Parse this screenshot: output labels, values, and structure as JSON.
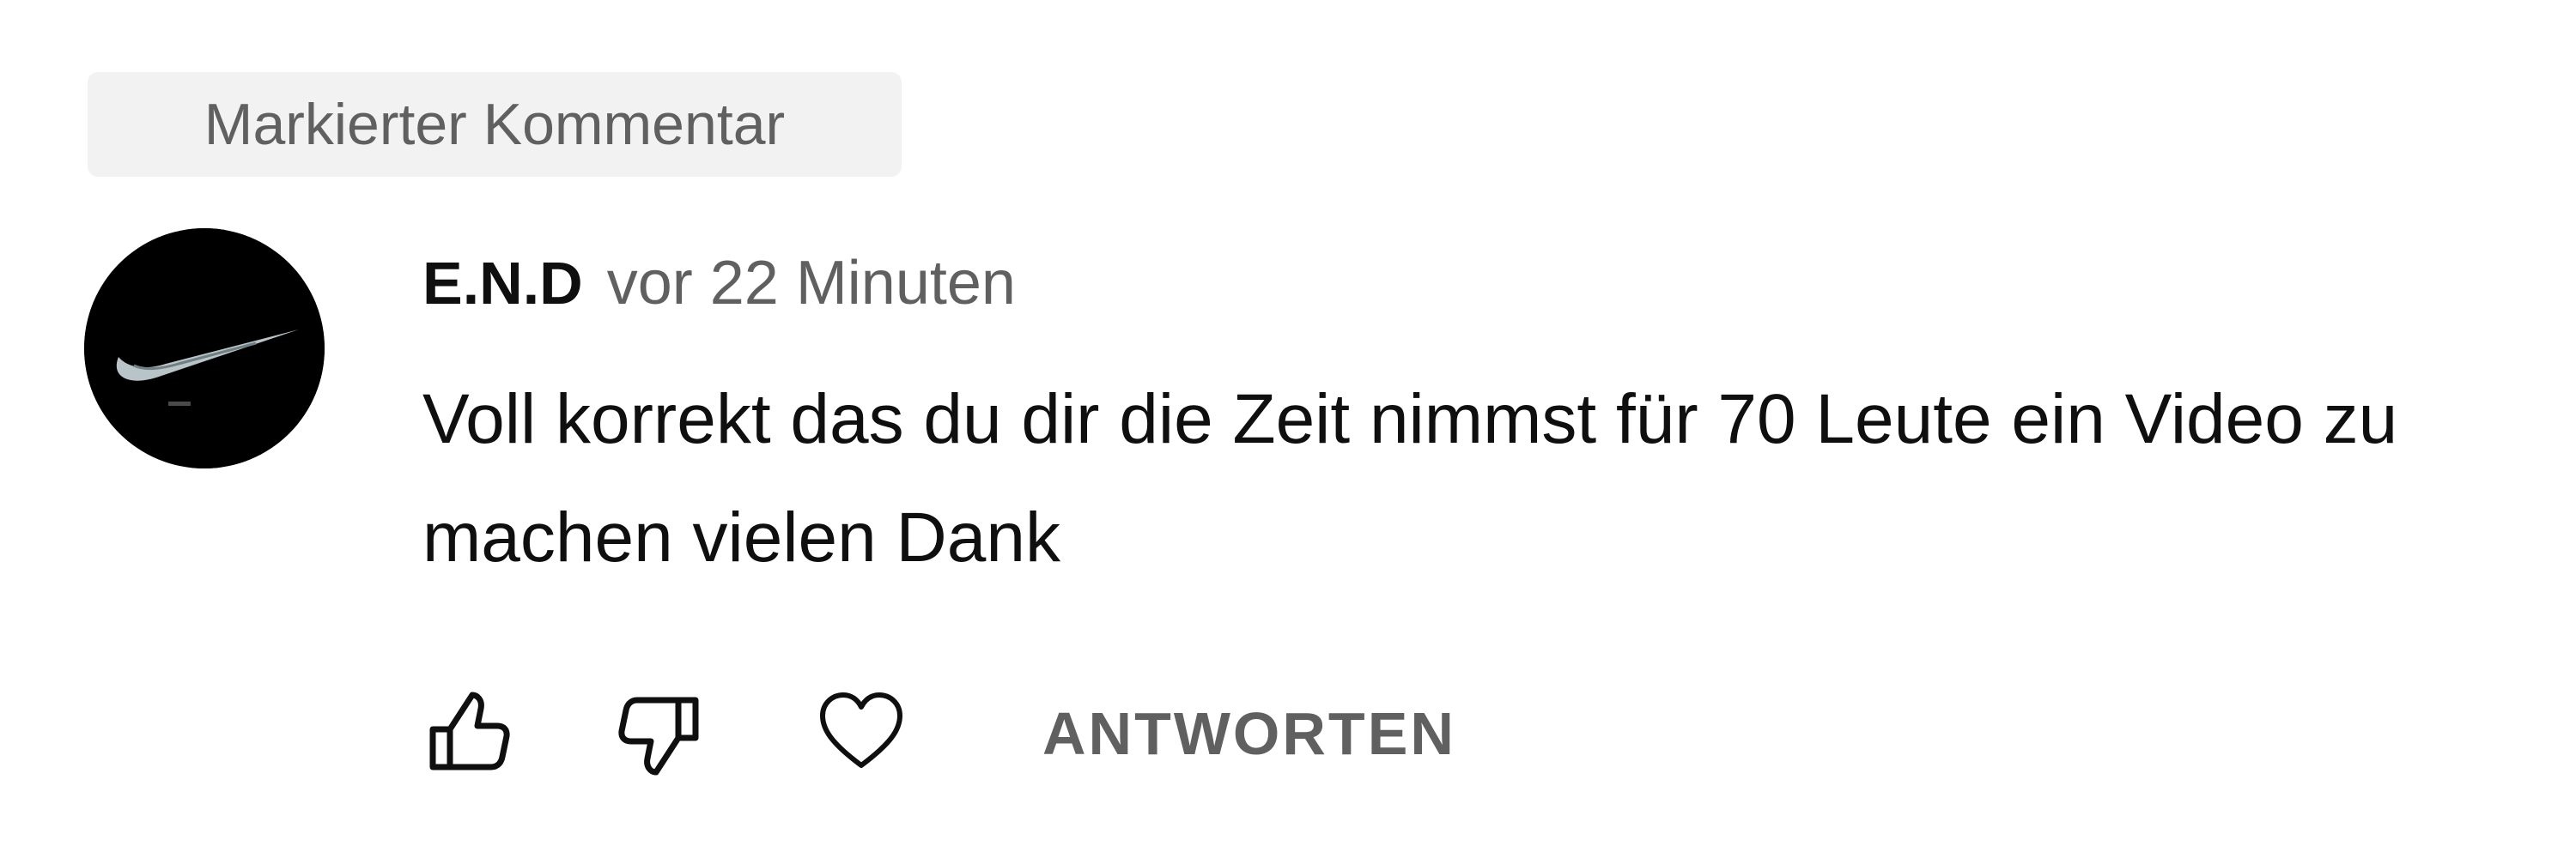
{
  "badge": {
    "label": "Markierter Kommentar"
  },
  "comment": {
    "author": "E.N.D",
    "time": "vor 22 Minuten",
    "text": "Voll korrekt das du dir die Zeit nimmst für 70 Leute ein Video zu machen vielen Dank"
  },
  "actions": {
    "like_icon": "thumbs-up-icon",
    "dislike_icon": "thumbs-down-icon",
    "heart_icon": "heart-icon",
    "reply_label": "ANTWORTEN"
  },
  "colors": {
    "background": "#ffffff",
    "badge_bg": "#f2f2f2",
    "primary_text": "#0f0f0f",
    "secondary_text": "#606060",
    "avatar_bg": "#000000"
  }
}
